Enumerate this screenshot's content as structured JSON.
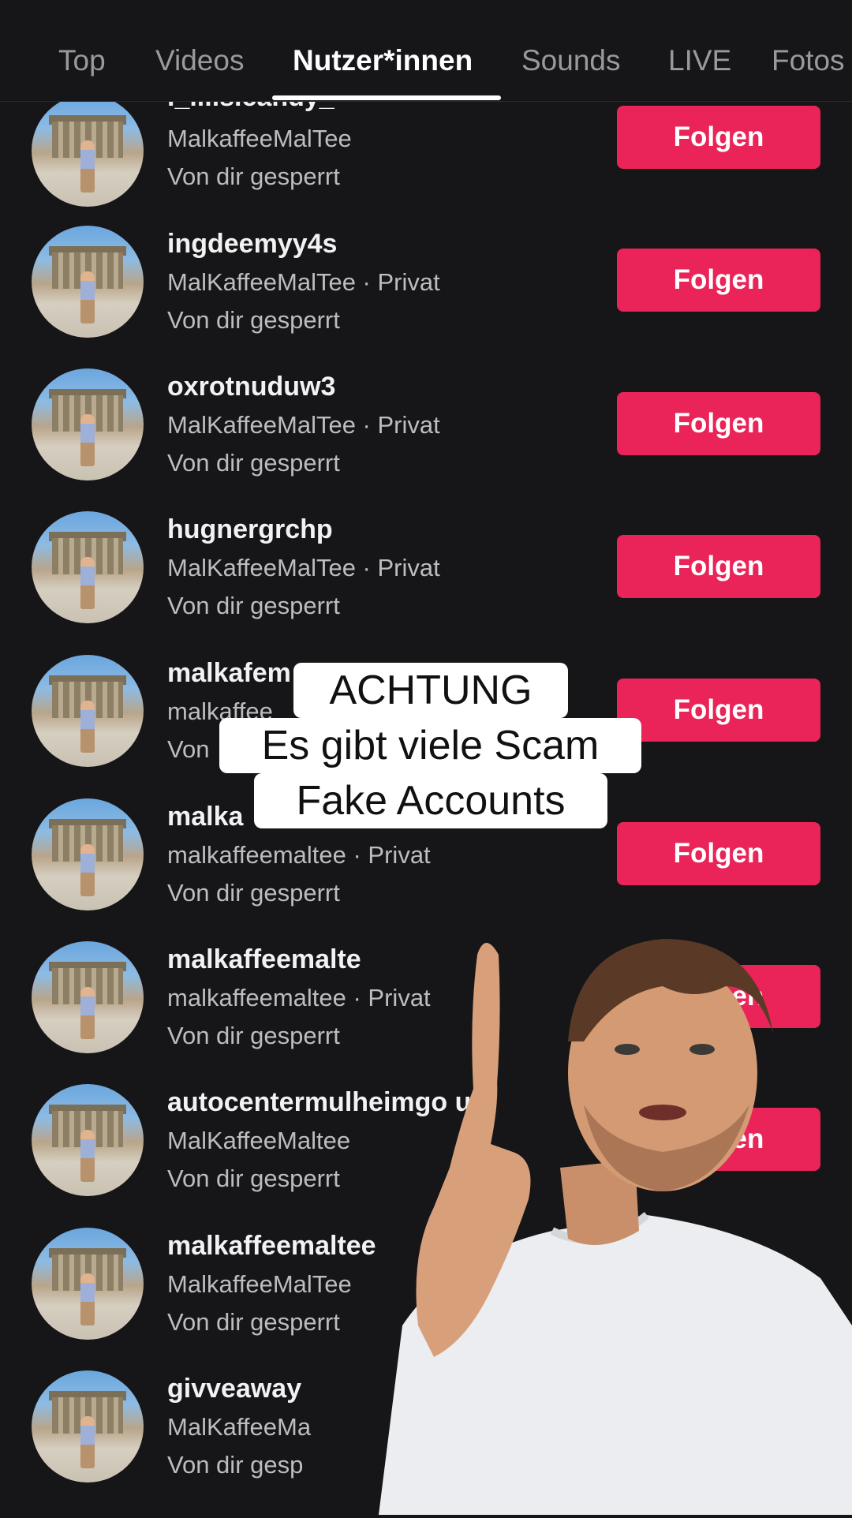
{
  "tabs": [
    {
      "label": "Top"
    },
    {
      "label": "Videos"
    },
    {
      "label": "Nutzer*innen",
      "active": true
    },
    {
      "label": "Sounds"
    },
    {
      "label": "LIVE"
    },
    {
      "label": "Fotos"
    }
  ],
  "follow_label": "Folgen",
  "accent_color": "#ea2458",
  "users": [
    {
      "username": "._lilis.candy_",
      "subtitle": "MalkaffeeMalTee",
      "status": "Von dir gesperrt"
    },
    {
      "username": "ingdeemyy4s",
      "subtitle": "MalKaffeeMalTee · Privat",
      "status": "Von dir gesperrt"
    },
    {
      "username": "oxrotnuduw3",
      "subtitle": "MalKaffeeMalTee · Privat",
      "status": "Von dir gesperrt"
    },
    {
      "username": "hugnergrchp",
      "subtitle": "MalKaffeeMalTee · Privat",
      "status": "Von dir gesperrt"
    },
    {
      "username": "malkafem",
      "subtitle": "malkaffee",
      "status": "Von"
    },
    {
      "username": "malka",
      "subtitle": "malkaffeemaltee · Privat",
      "status": "Von dir gesperrt"
    },
    {
      "username": "malkaffeemalte",
      "subtitle": "malkaffeemaltee · Privat",
      "status": "Von dir gesperrt"
    },
    {
      "username": "autocentermulheimgo uh",
      "subtitle": "MalKaffeeMaltee",
      "status": "Von dir gesperrt"
    },
    {
      "username": "malkaffeemaltee",
      "subtitle": "MalkaffeeMalTee",
      "status": "Von dir gesperrt"
    },
    {
      "username": "givveaway",
      "subtitle": "MalKaffeeMa",
      "status": "Von dir gesp"
    }
  ],
  "caption": {
    "line1": "ACHTUNG",
    "line2": "Es gibt viele Scam",
    "line3": "Fake Accounts"
  }
}
